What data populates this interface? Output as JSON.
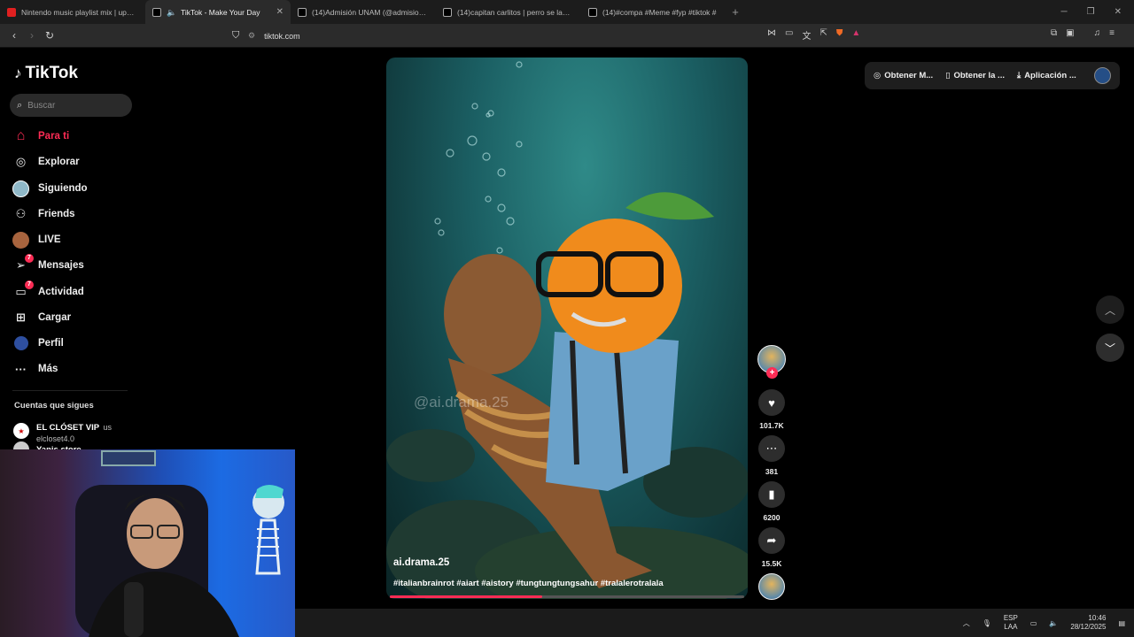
{
  "browser": {
    "tabs": [
      {
        "title": "Nintendo music playlist mix | upbeat",
        "active": false,
        "color": "#e02020"
      },
      {
        "title": "TikTok - Make Your Day",
        "active": true,
        "color": "#ffffff"
      },
      {
        "title": "(14)Admisión UNAM (@admision.un",
        "active": false,
        "color": "#ffffff"
      },
      {
        "title": "(14)capitan carlitos | perro se lanza al",
        "active": false,
        "color": "#ffffff"
      },
      {
        "title": "(14)#compa #Meme #fyp #tiktok #",
        "active": false,
        "color": "#ffffff"
      }
    ],
    "new_tab": "+",
    "url": "tiktok.com"
  },
  "tiktok": {
    "logo": "TikTok",
    "search_placeholder": "Buscar",
    "nav": [
      {
        "label": "Para ti",
        "icon": "home-icon",
        "glyph": "⌂",
        "active": true,
        "badge": ""
      },
      {
        "label": "Explorar",
        "icon": "compass-icon",
        "glyph": "◎",
        "active": false,
        "badge": ""
      },
      {
        "label": "Siguiendo",
        "icon": "avatar-icon",
        "glyph": "●",
        "active": false,
        "badge": ""
      },
      {
        "label": "Friends",
        "icon": "friends-icon",
        "glyph": "⚇",
        "active": false,
        "badge": ""
      },
      {
        "label": "LIVE",
        "icon": "live-icon",
        "glyph": "●",
        "active": false,
        "badge": ""
      },
      {
        "label": "Mensajes",
        "icon": "send-icon",
        "glyph": "➢",
        "active": false,
        "badge": "7"
      },
      {
        "label": "Actividad",
        "icon": "inbox-icon",
        "glyph": "▭",
        "active": false,
        "badge": "7"
      },
      {
        "label": "Cargar",
        "icon": "upload-icon",
        "glyph": "⊞",
        "active": false,
        "badge": ""
      },
      {
        "label": "Perfil",
        "icon": "profile-icon",
        "glyph": "●",
        "active": false,
        "badge": ""
      },
      {
        "label": "Más",
        "icon": "more-icon",
        "glyph": "···",
        "active": false,
        "badge": ""
      }
    ],
    "following_title": "Cuentas que sigues",
    "following": [
      {
        "name": "EL CLÓSET VIP",
        "suffix": "us",
        "handle": "elcloset4.0"
      },
      {
        "name": "Yanis store",
        "suffix": "",
        "handle": ""
      }
    ],
    "top_actions": [
      {
        "label": "Obtener M...",
        "icon": "coin-icon",
        "glyph": "◎"
      },
      {
        "label": "Obtener la ...",
        "icon": "phone-icon",
        "glyph": "▯"
      },
      {
        "label": "Aplicación ...",
        "icon": "download-icon",
        "glyph": "⤓"
      }
    ],
    "video": {
      "author": "ai.drama.25",
      "hashtags": "#italianbrainrot #aiart #aistory #tungtungtungsahur #tralalerotralala",
      "watermark": "@ai.drama.25",
      "progress": 0.43
    },
    "actions": {
      "likes": "101.7K",
      "comments": "381",
      "saves": "6200",
      "shares": "15.5K"
    }
  },
  "taskbar": {
    "lang_top": "ESP",
    "lang_bottom": "LAA",
    "time": "10:46",
    "date": "28/12/2025"
  },
  "colors": {
    "accent": "#fe2c55"
  }
}
